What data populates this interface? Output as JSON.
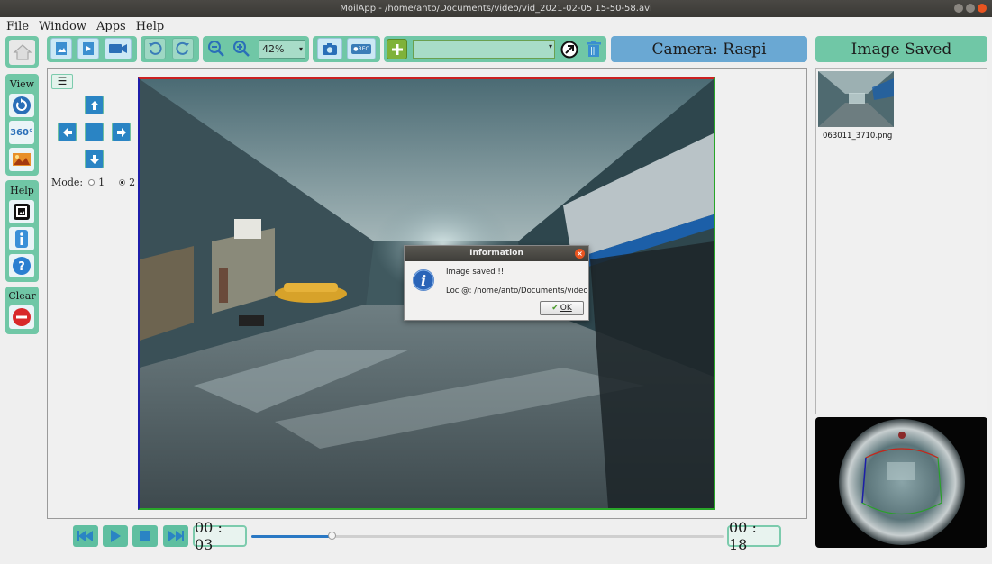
{
  "window": {
    "title": "MoilApp - /home/anto/Documents/video/vid_2021-02-05 15-50-58.avi"
  },
  "menu": [
    "File",
    "Window",
    "Apps",
    "Help"
  ],
  "toolbar": {
    "zoom_value": "42%",
    "rec_label": "●REC",
    "combo_value": ""
  },
  "banners": {
    "camera": "Camera: Raspi",
    "status": "Image Saved"
  },
  "sidebar": {
    "view_label": "View",
    "help_label": "Help",
    "clear_label": "Clear",
    "label_360": "360°"
  },
  "controls": {
    "menu_icon": "☰",
    "mode_label": "Mode:",
    "mode_options": [
      "1",
      "2"
    ],
    "mode_selected": "2"
  },
  "dialog": {
    "title": "Information",
    "message": "Image saved !!",
    "location": "Loc @: /home/anto/Documents/video",
    "ok_label": "OK"
  },
  "thumbnails": [
    {
      "filename": "063011_3710.png"
    }
  ],
  "playback": {
    "current_time": "00 : 03",
    "total_time": "00 : 18",
    "progress": 0.17
  },
  "colors": {
    "accent_green": "#70c7a6",
    "banner_blue": "#6aa8d3",
    "banner_green": "#70c7a6"
  },
  "icons": [
    "home-icon",
    "image-icon",
    "video-file-icon",
    "camera-video-icon",
    "rotate-left-icon",
    "rotate-right-icon",
    "zoom-out-icon",
    "zoom-in-icon",
    "snapshot-icon",
    "add-icon",
    "arrow-circle-icon",
    "trash-icon",
    "refresh-icon",
    "panorama-icon",
    "gallery-icon",
    "info-icon",
    "help-icon",
    "clear-icon"
  ]
}
